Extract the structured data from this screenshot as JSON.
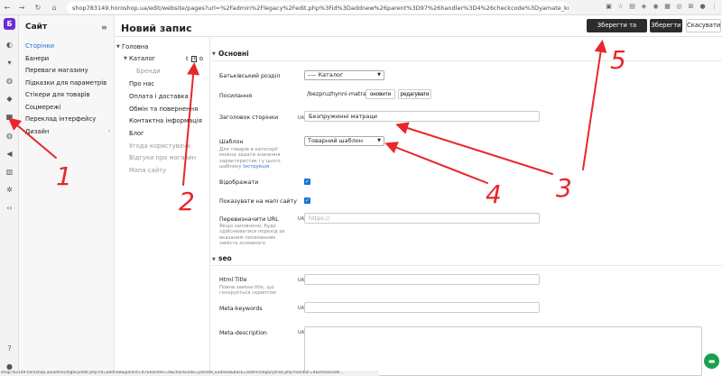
{
  "browser": {
    "url": "shop783149.horoshop.ua/edit/website/pages?url=%2Fadmin%2Flegacy%2Fedit.php%3Fid%3Daddnew%26parent%3D97%26handler%3D4%26checkcode%3Dyamate_kudasai%26back%3D%252Fadmin",
    "status_url": "shop783149.horoshop.ua/admin/legacy/edit.php?id=addnew&parent=97&handler=4&checkcode=yamate_kudasai&back=/admin/legacy/tree.php?handler=4&checkcode..."
  },
  "sidebar": {
    "title": "Сайт",
    "items": [
      {
        "label": "Сторінки",
        "active": true
      },
      {
        "label": "Банери"
      },
      {
        "label": "Переваги магазину"
      },
      {
        "label": "Підказки для параметрів"
      },
      {
        "label": "Стікери для товарів"
      },
      {
        "label": "Соцмережі"
      },
      {
        "label": "Переклад інтерфейсу"
      },
      {
        "label": "Дизайн"
      }
    ]
  },
  "header": {
    "title": "Новий запис",
    "save_exit_label": "Зберегти та вийти",
    "save_label": "Зберегти",
    "cancel_label": "Скасувати"
  },
  "tree": {
    "root": "Головна",
    "catalog": "Каталог",
    "brands": "Бренди",
    "items": [
      "Про нас",
      "Оплата і доставка",
      "Обмін та повернення",
      "Контактна інформація",
      "Блог"
    ],
    "muted_items": [
      "Угода користувача",
      "Відгуки про магазин",
      "Мапа сайту"
    ]
  },
  "form": {
    "section_main": "Основні",
    "parent_label": "Батьківський розділ",
    "parent_value": "---- Каталог",
    "link_label": "Посилання",
    "link_value": "/bezpruzhynni-matratsy/",
    "update_btn": "оновити",
    "edit_btn": "редагувати",
    "heading_label": "Заголовок сторінки",
    "heading_value": "Безпружинні матраци",
    "template_label": "Шаблон",
    "template_hint": "Для товарів в категорії можна задати значення характеристик і у цього шаблону",
    "template_hint_link": "Інструкція",
    "template_value": "Товарний шаблон",
    "display_label": "Відображати",
    "show_map_label": "Показувати на мапі сайту",
    "override_label": "Перевизначити URL",
    "override_hint": "Якщо заповнено, буде здійснюватися перехід за вказаним посиланням замість основного",
    "override_placeholder": "https://",
    "section_seo": "seo",
    "html_title_label": "Html Title",
    "html_title_hint": "Повна заміна title, що генерується скриптом",
    "meta_keywords_label": "Meta-keywords",
    "meta_description_label": "Meta-description",
    "ua": "UA"
  },
  "annotations": [
    "1",
    "2",
    "3",
    "4",
    "5"
  ],
  "colors": {
    "accent": "#1f6fd0",
    "annotation": "#e8262c",
    "brand": "#6a2bd9"
  }
}
